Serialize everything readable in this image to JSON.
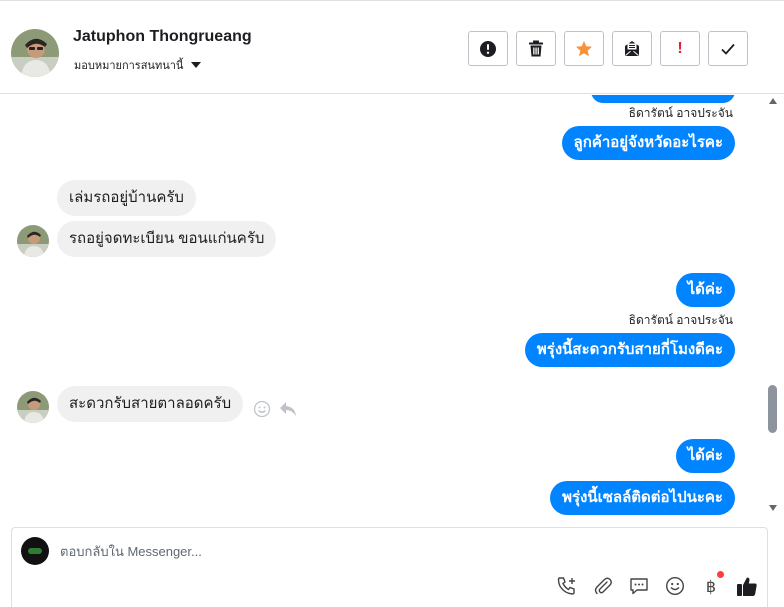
{
  "header": {
    "contact_name": "Jatuphon Thongrueang",
    "assign_label": "มอบหมายการสนทนานี้",
    "actions": [
      {
        "name": "follow-up",
        "icon": "alert-circle-icon"
      },
      {
        "name": "delete",
        "icon": "trash-icon"
      },
      {
        "name": "star",
        "icon": "star-icon"
      },
      {
        "name": "mark-unread",
        "icon": "envelope-icon"
      },
      {
        "name": "spam",
        "icon": "exclamation-icon",
        "label": "!"
      },
      {
        "name": "mark-done",
        "icon": "check-icon"
      }
    ]
  },
  "conversation": {
    "messages": [
      {
        "type": "outgoing",
        "sender": "ธิดารัตน์ อาจประจัน",
        "text": "ลูกค้าอยู่จังหวัดอะไรคะ"
      },
      {
        "type": "incoming",
        "text": "เล่มรถอยู่บ้านครับ"
      },
      {
        "type": "incoming",
        "text": "รถอยู่จดทะเบียน ขอนแก่นครับ"
      },
      {
        "type": "outgoing",
        "text": "ได้ค่ะ"
      },
      {
        "type": "outgoing",
        "sender": "ธิดารัตน์ อาจประจัน",
        "text": "พรุ่งนี้สะดวกรับสายกี่โมงดีคะ"
      },
      {
        "type": "incoming",
        "text": "สะดวกรับสายตาลอดครับ"
      },
      {
        "type": "outgoing",
        "text": "ได้ค่ะ"
      },
      {
        "type": "outgoing",
        "text": "พรุ่งนี้เซลล์ติดต่อไปนะคะ"
      }
    ]
  },
  "composer": {
    "placeholder": "ตอบกลับใน Messenger...",
    "currency_symbol": "฿",
    "tools": [
      "add-call-icon",
      "paperclip-icon",
      "saved-reply-icon",
      "emoji-icon",
      "baht-icon",
      "thumbs-up-icon"
    ]
  },
  "colors": {
    "accent": "#0084ff",
    "incoming_bubble": "#f1f0f0",
    "star": "#f7923a",
    "alert": "#e41e3f"
  }
}
